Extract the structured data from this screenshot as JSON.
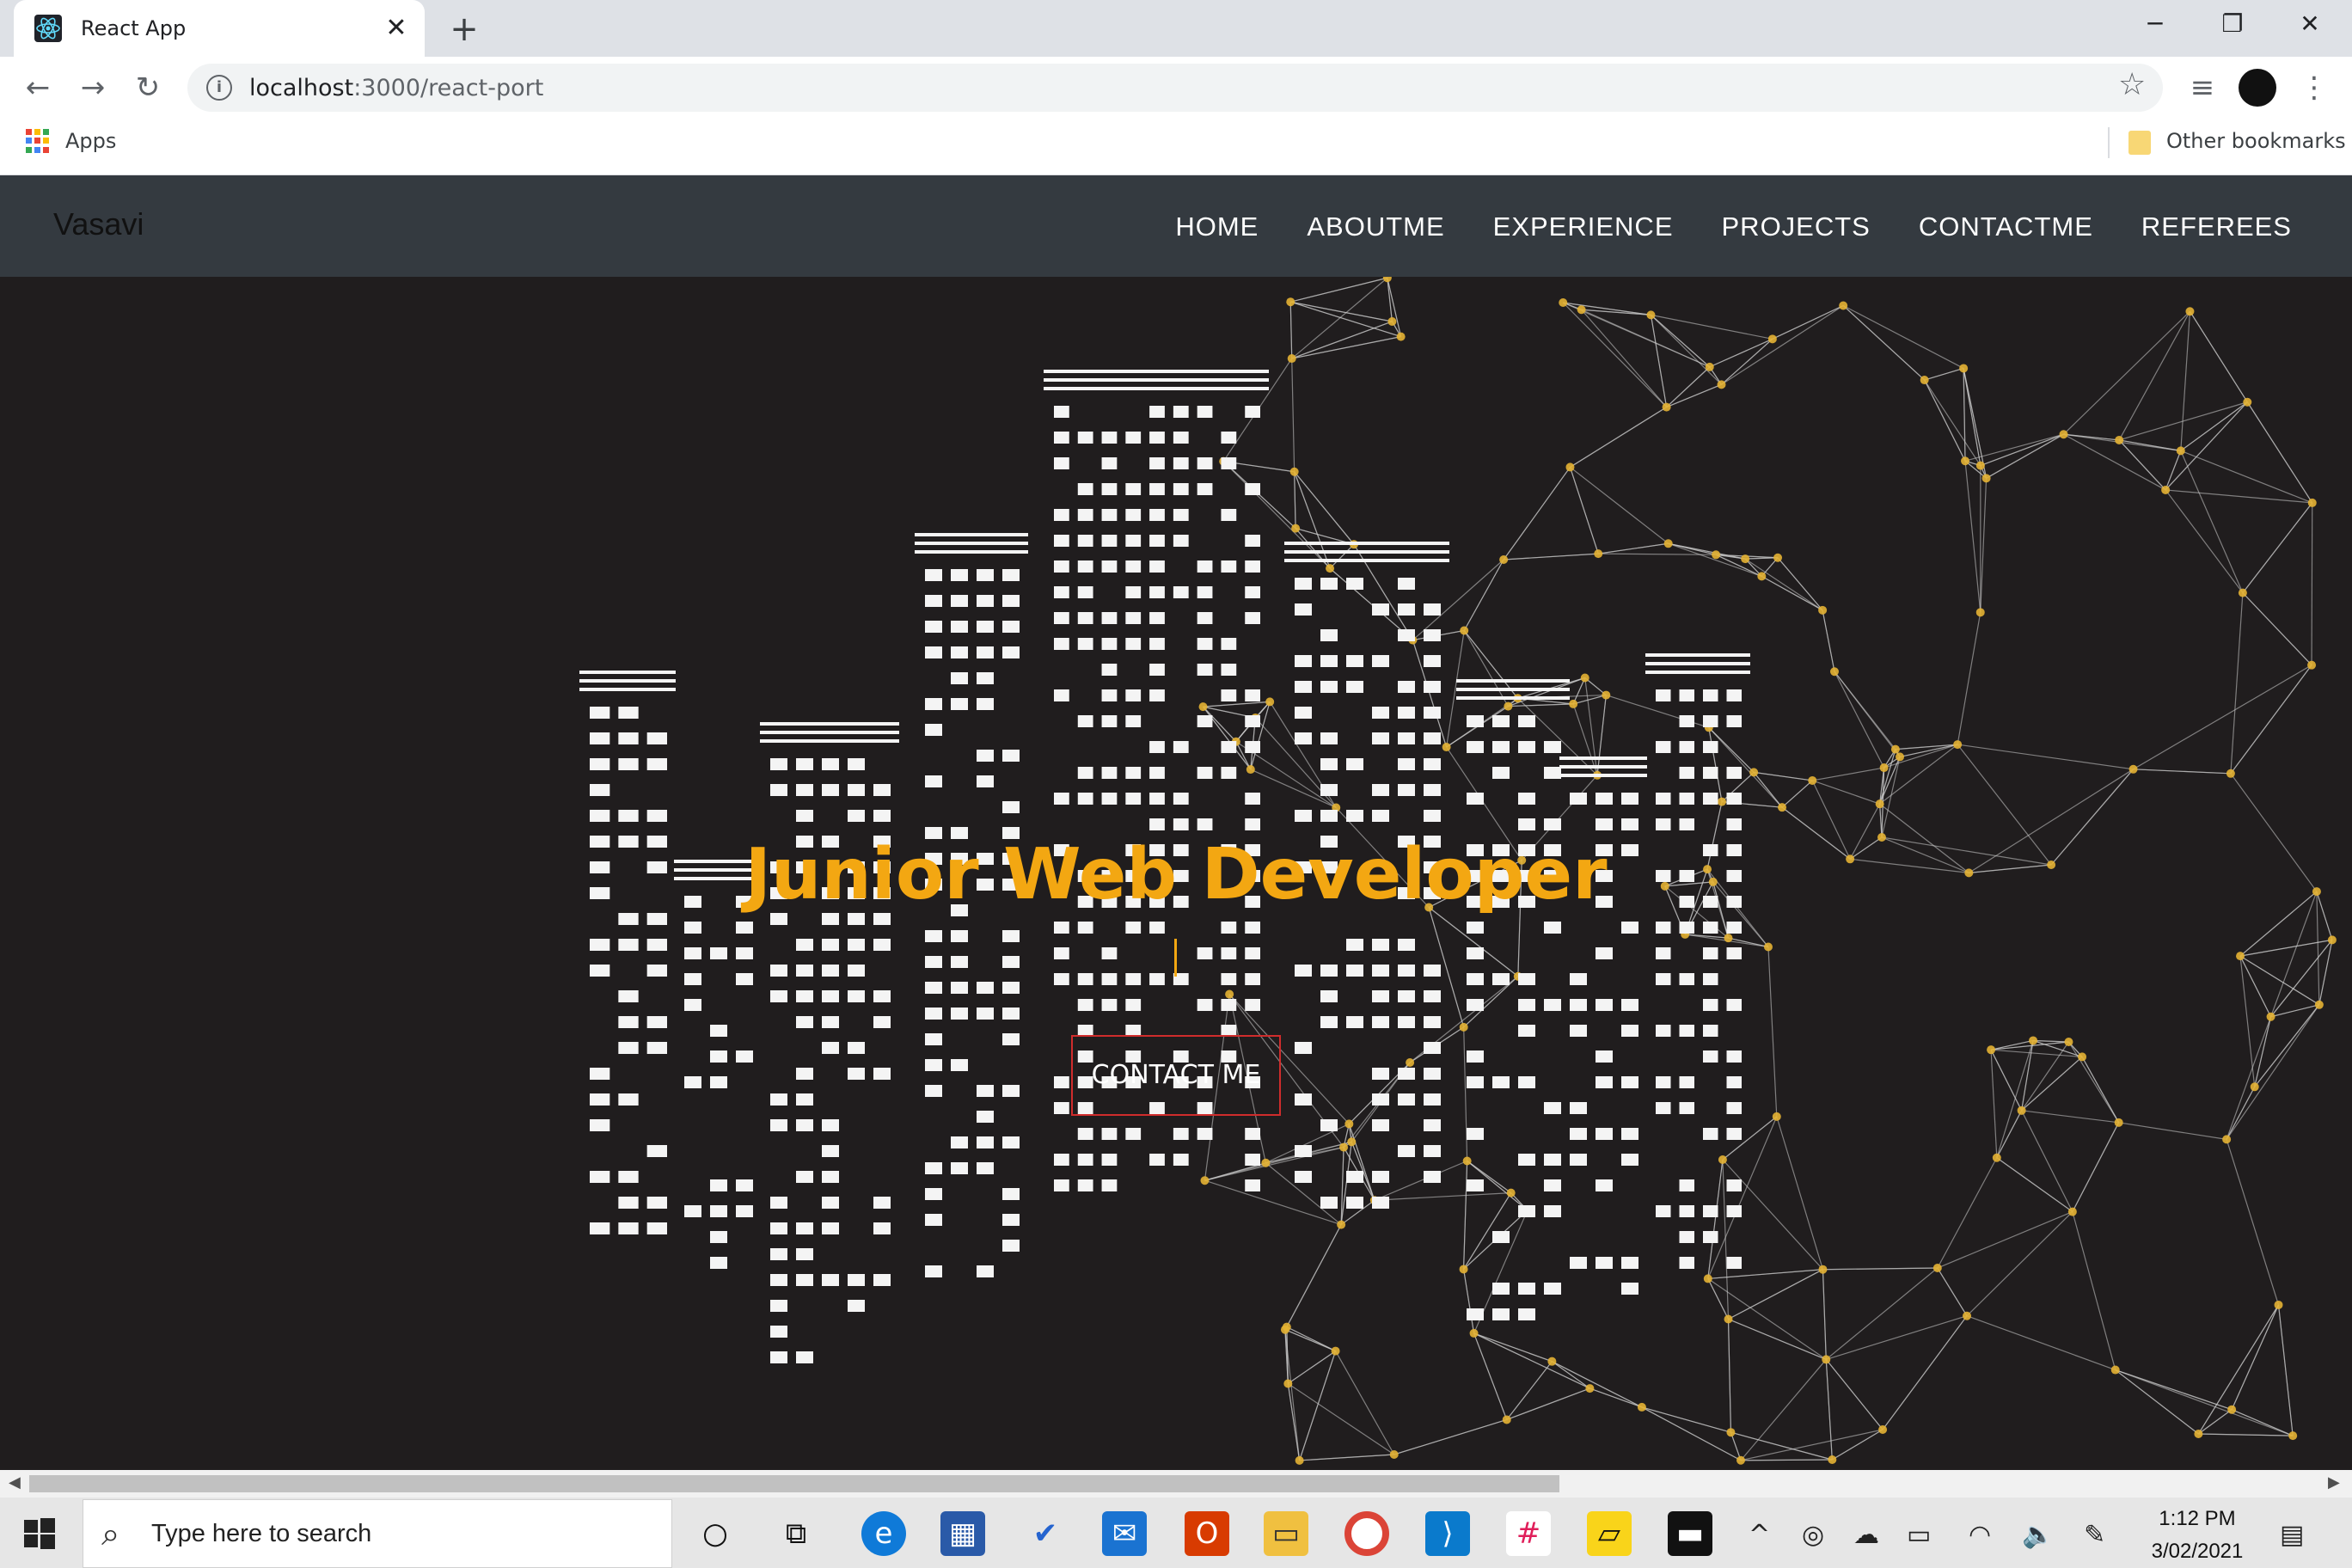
{
  "browser": {
    "tab_title": "React App",
    "tab_close": "✕",
    "new_tab": "+",
    "url_host": "localhost",
    "url_path": ":3000/react-port",
    "bookmarks": {
      "apps": "Apps",
      "other": "Other bookmarks"
    }
  },
  "app": {
    "brand": "Vasavi",
    "nav": [
      "HOME",
      "ABOUTME",
      "EXPERIENCE",
      "PROJECTS",
      "CONTACTME",
      "REFEREES"
    ],
    "hero_title": "Junior Web Developer",
    "cta": "CONTACT ME",
    "accent_color": "#f3a712",
    "button_border_color": "#d02c2c"
  },
  "taskbar": {
    "search_placeholder": "Type here to search",
    "time": "1:12 PM",
    "date": "3/02/2021"
  }
}
